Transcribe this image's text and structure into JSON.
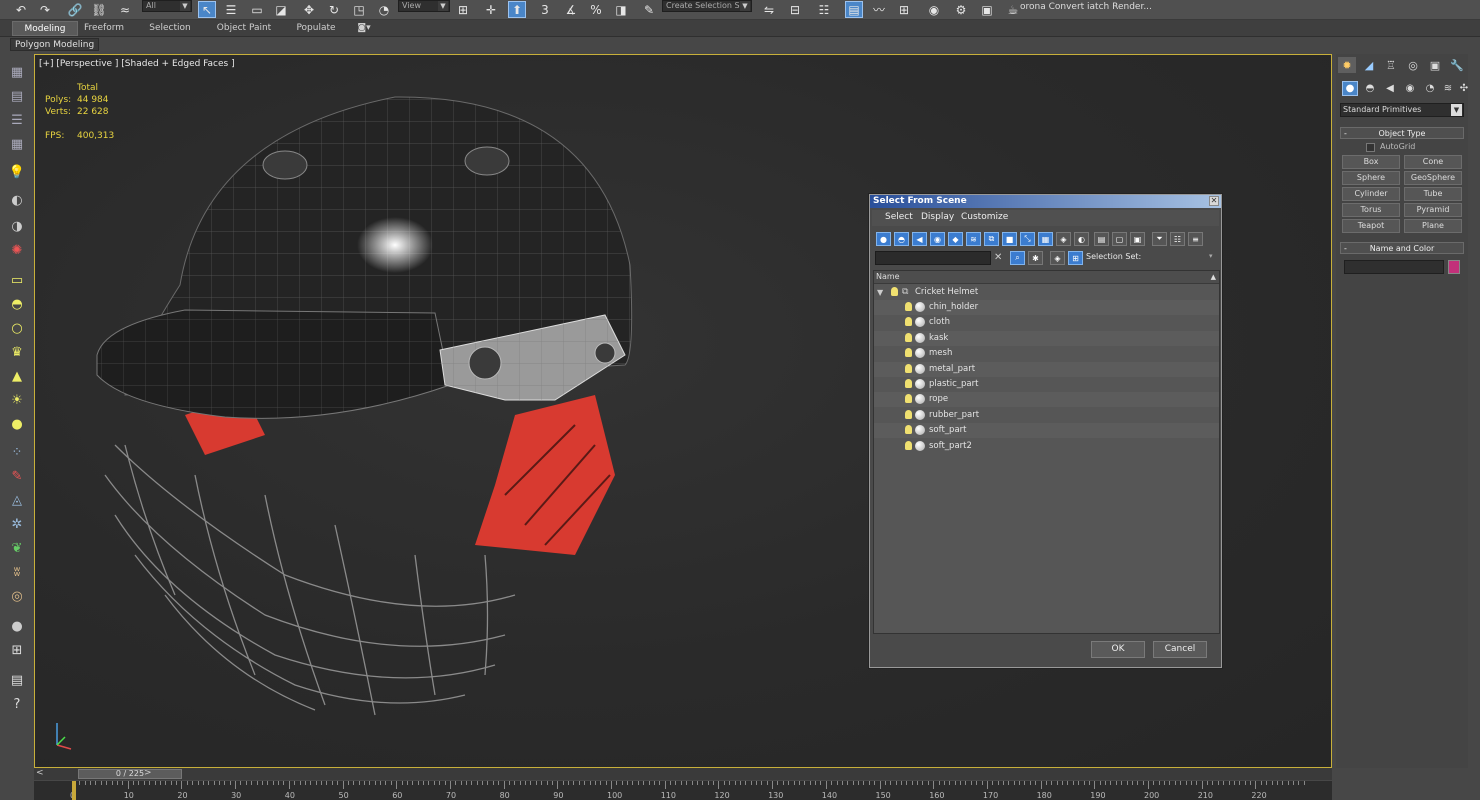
{
  "toolbar": {
    "selection_filter": "All",
    "view_dropdown": "View",
    "create_selection_set": "Create Selection Se",
    "corona_label": "orona Convert iatch Render..."
  },
  "ribbon": {
    "tabs": [
      "Modeling",
      "Freeform",
      "Selection",
      "Object Paint",
      "Populate"
    ],
    "sub_label": "Polygon Modeling"
  },
  "viewport": {
    "label": "[+] [Perspective ] [Shaded + Edged Faces ]",
    "stats": {
      "total_label": "Total",
      "polys_label": "Polys:",
      "polys_value": "44 984",
      "verts_label": "Verts:",
      "verts_value": "22 628",
      "fps_label": "FPS:",
      "fps_value": "400,313"
    }
  },
  "command_panel": {
    "dropdown": "Standard Primitives",
    "object_type_title": "Object Type",
    "autogrid_label": "AutoGrid",
    "buttons": [
      "Box",
      "Cone",
      "Sphere",
      "GeoSphere",
      "Cylinder",
      "Tube",
      "Torus",
      "Pyramid",
      "Teapot",
      "Plane"
    ],
    "name_color_title": "Name and Color",
    "object_color": "#c2307a"
  },
  "timeline": {
    "frame": "0 / 225",
    "ticks": [
      "0",
      "10",
      "20",
      "30",
      "40",
      "50",
      "60",
      "70",
      "80",
      "90",
      "100",
      "110",
      "120",
      "130",
      "140",
      "150",
      "160",
      "170",
      "180",
      "190",
      "200",
      "210",
      "220"
    ]
  },
  "dialog": {
    "title": "Select From Scene",
    "menu": [
      "Select",
      "Display",
      "Customize"
    ],
    "selection_set_label": "Selection Set:",
    "column_name": "Name",
    "root": "Cricket Helmet",
    "children": [
      "chin_holder",
      "cloth",
      "kask",
      "mesh",
      "metal_part",
      "plastic_part",
      "rope",
      "rubber_part",
      "soft_part",
      "soft_part2"
    ],
    "ok": "OK",
    "cancel": "Cancel"
  }
}
